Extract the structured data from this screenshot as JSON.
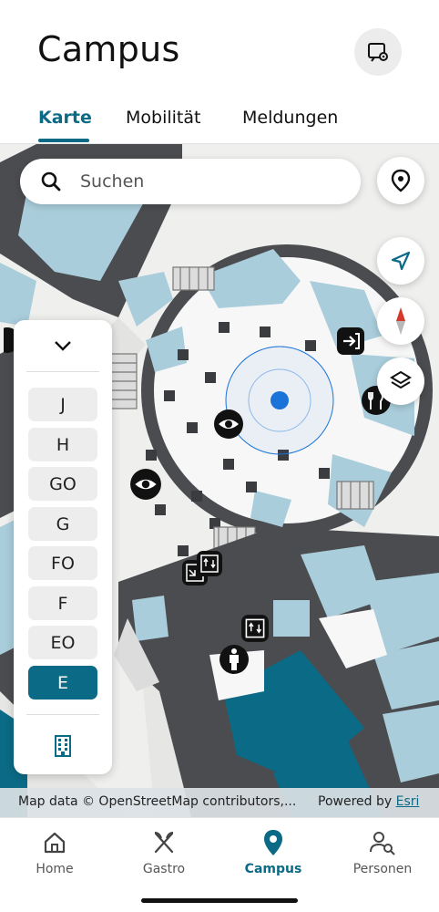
{
  "header": {
    "title": "Campus",
    "settings_icon": "map-settings-icon"
  },
  "tabs": [
    {
      "label": "Karte",
      "active": true
    },
    {
      "label": "Mobilität",
      "active": false
    },
    {
      "label": "Meldungen",
      "active": false
    }
  ],
  "map": {
    "search": {
      "placeholder": "Suchen",
      "icon": "search-icon"
    },
    "controls": [
      "location-pin-icon",
      "navigation-arrow-icon",
      "compass-icon",
      "layers-icon"
    ],
    "poi_icons": [
      "eye-icon",
      "entrance-icon",
      "restaurant-icon",
      "stairs-icon",
      "elevator-icon",
      "person-icon"
    ],
    "levels": {
      "items": [
        "J",
        "H",
        "GO",
        "G",
        "FO",
        "F",
        "EO",
        "E"
      ],
      "selected": "E",
      "collapse_icon": "chevron-down-icon",
      "building_icon": "building-icon"
    },
    "attribution": {
      "left": "Map data © OpenStreetMap contributors,...",
      "powered_by": "Powered by",
      "powered_link": "Esri"
    }
  },
  "bottom_nav": [
    {
      "label": "Home",
      "icon": "home-icon",
      "active": false
    },
    {
      "label": "Gastro",
      "icon": "fork-knife-icon",
      "active": false
    },
    {
      "label": "Campus",
      "icon": "map-pin-icon",
      "active": true
    },
    {
      "label": "Personen",
      "icon": "person-search-icon",
      "active": false
    }
  ],
  "colors": {
    "accent": "#0b6a85",
    "room_light": "#a9cddb",
    "wall": "#4a4c4f",
    "location": "#1a73d9"
  }
}
